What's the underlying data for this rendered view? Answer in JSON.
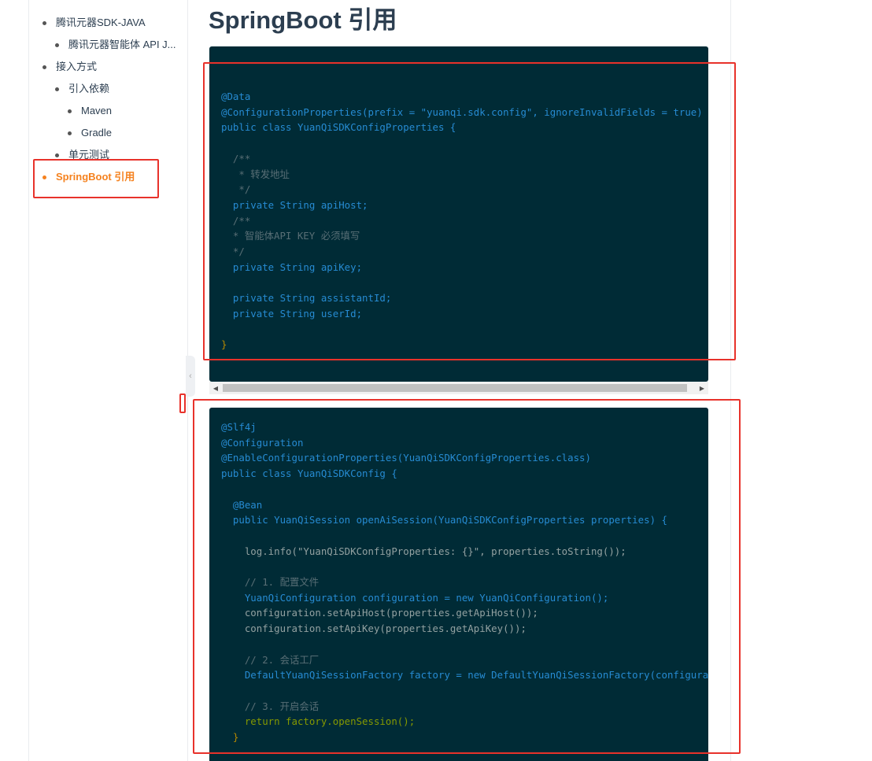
{
  "toc": {
    "items": [
      {
        "label": "腾讯元器SDK-JAVA",
        "level": 1,
        "active": false
      },
      {
        "label": "腾讯元器智能体 API J...",
        "level": 2,
        "active": false
      },
      {
        "label": "接入方式",
        "level": 1,
        "active": false
      },
      {
        "label": "引入依赖",
        "level": 2,
        "active": false
      },
      {
        "label": "Maven",
        "level": 3,
        "active": false
      },
      {
        "label": "Gradle",
        "level": 3,
        "active": false
      },
      {
        "label": "单元测试",
        "level": 2,
        "active": false
      },
      {
        "label": "SpringBoot 引用",
        "level": 1,
        "active": true
      }
    ]
  },
  "collapse_icon": "chevron-left-icon",
  "page": {
    "title": "SpringBoot 引用"
  },
  "code_blocks": [
    {
      "lines": [
        "@Data",
        "@ConfigurationProperties(prefix = \"yuanqi.sdk.config\", ignoreInvalidFields = true)",
        "public class YuanQiSDKConfigProperties {",
        "",
        "  /**",
        "   * 转发地址",
        "   */",
        "  private String apiHost;",
        "  /**",
        "  * 智能体API KEY 必须填写",
        "  */",
        "  private String apiKey;",
        "",
        "  private String assistantId;",
        "  private String userId;",
        "",
        "}"
      ]
    },
    {
      "lines": [
        "@Slf4j",
        "@Configuration",
        "@EnableConfigurationProperties(YuanQiSDKConfigProperties.class)",
        "public class YuanQiSDKConfig {",
        "",
        "  @Bean",
        "  public YuanQiSession openAiSession(YuanQiSDKConfigProperties properties) {",
        "",
        "    log.info(\"YuanQiSDKConfigProperties: {}\", properties.toString());",
        "",
        "    // 1. 配置文件",
        "    YuanQiConfiguration configuration = new YuanQiConfiguration();",
        "    configuration.setApiHost(properties.getApiHost());",
        "    configuration.setApiKey(properties.getApiKey());",
        "",
        "    // 2. 会话工厂",
        "    DefaultYuanQiSessionFactory factory = new DefaultYuanQiSessionFactory(configuration);",
        "",
        "    // 3. 开启会话",
        "    return factory.openSession();",
        "  }"
      ]
    }
  ],
  "scrollbar": {
    "left_arrow": "◀",
    "right_arrow": "▶"
  },
  "colors": {
    "accent": "#f5821f",
    "code_bg": "#002b36",
    "annotation_red": "#e8322b"
  }
}
